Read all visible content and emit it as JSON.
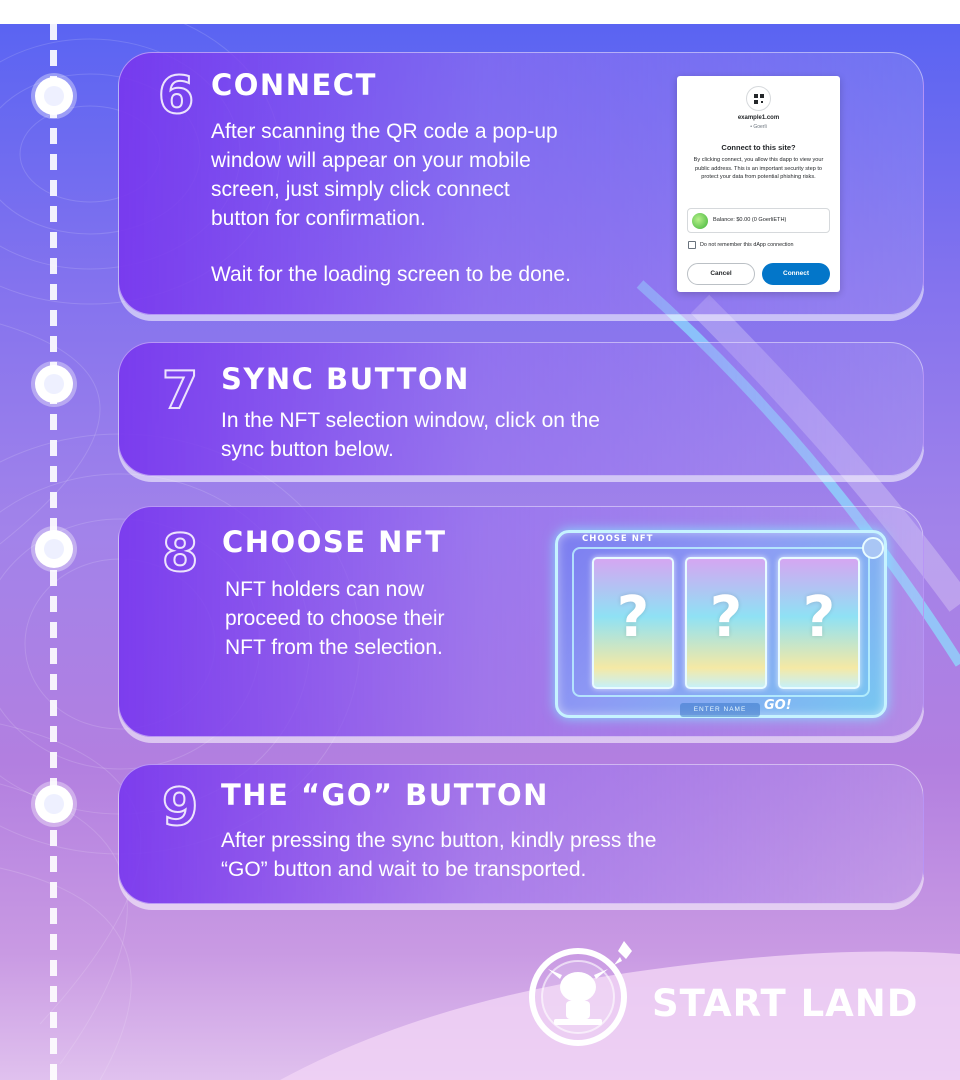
{
  "steps": [
    {
      "number": "6",
      "title": "CONNECT",
      "paragraphs": [
        "After scanning the QR code a pop-up",
        "window will appear on your mobile",
        "screen, just simply click connect",
        "button for confirmation."
      ],
      "extra": "Wait for the loading screen to be done."
    },
    {
      "number": "7",
      "title": "SYNC  BUTTON",
      "lines": [
        "In the NFT selection window, click on the",
        "sync button below."
      ]
    },
    {
      "number": "8",
      "title": "CHOOSE  NFT",
      "lines": [
        "NFT holders can now",
        "proceed to choose their",
        "NFT from the selection."
      ]
    },
    {
      "number": "9",
      "title": "THE  “GO”  BUTTON",
      "lines": [
        "After pressing the sync button, kindly press the",
        "“GO” button and wait to be transported."
      ]
    }
  ],
  "connect_dialog": {
    "site": "example1.com",
    "network": "• Goerli",
    "question": "Connect to this site?",
    "description": "By clicking connect, you allow this dapp to view your public address. This is an important security step to protect your data from potential phishing risks.",
    "balance": "Balance: $0.00 (0 GoerliETH)",
    "checkbox_label": "Do not remember this dApp connection",
    "cancel_label": "Cancel",
    "connect_label": "Connect",
    "connect_color": "#0376c9"
  },
  "nft_panel": {
    "label": "CHOOSE NFT",
    "cards": [
      "?",
      "?",
      "?"
    ],
    "name_input": "ENTER NAME",
    "go_label": "GO!"
  },
  "brand": {
    "name": "START LAND",
    "icons": [
      "alien-mascot-icon",
      "rocket-icon"
    ]
  },
  "colors": {
    "accent_purple": "#7837ee",
    "background_top": "#5a64f2",
    "background_bottom": "#e0c1ee"
  }
}
